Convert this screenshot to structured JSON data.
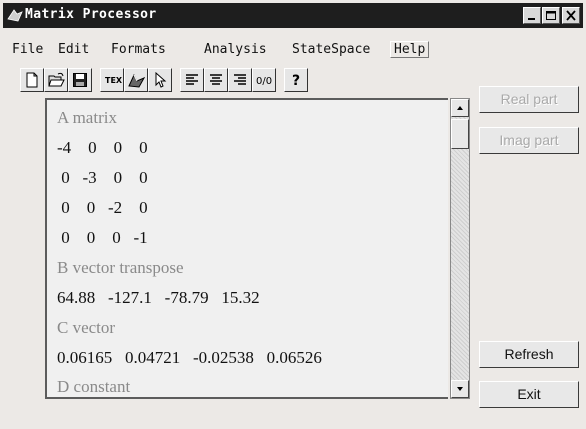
{
  "window": {
    "title": "Matrix Processor"
  },
  "menu": [
    {
      "label": "File"
    },
    {
      "label": "Edit"
    },
    {
      "label": "Formats"
    },
    {
      "label": "Analysis"
    },
    {
      "label": "StateSpace"
    },
    {
      "label": "Help"
    }
  ],
  "toolbar": {
    "items": [
      "new-file-icon",
      "open-folder-icon",
      "save-icon",
      "tex-icon",
      "simulink-icon",
      "pointer-icon",
      "align-left-icon",
      "align-center-icon",
      "align-right-icon",
      "rational-format-icon",
      "help-icon"
    ],
    "tex_label": "TEX",
    "rational_label": "0/0",
    "help_label": "?"
  },
  "matrix_display": {
    "lines": [
      {
        "text": "A matrix",
        "kind": "heading"
      },
      {
        "text": "-4    0    0    0",
        "kind": "value"
      },
      {
        "text": " 0   -3    0    0",
        "kind": "value"
      },
      {
        "text": " 0    0   -2    0",
        "kind": "value"
      },
      {
        "text": " 0    0    0   -1",
        "kind": "value"
      },
      {
        "text": "B vector transpose",
        "kind": "heading"
      },
      {
        "text": "64.88   -127.1   -78.79   15.32",
        "kind": "value"
      },
      {
        "text": "C vector",
        "kind": "heading"
      },
      {
        "text": "0.06165   0.04721   -0.02538   0.06526",
        "kind": "value"
      },
      {
        "text": "D constant",
        "kind": "heading"
      }
    ]
  },
  "buttons": {
    "real_part": "Real part",
    "imag_part": "Imag part",
    "refresh": "Refresh",
    "exit": "Exit"
  },
  "colors": {
    "title_bar": "#1e1e1e",
    "heading_text": "#8a8a8a",
    "disabled_text": "#a9a9a9"
  }
}
